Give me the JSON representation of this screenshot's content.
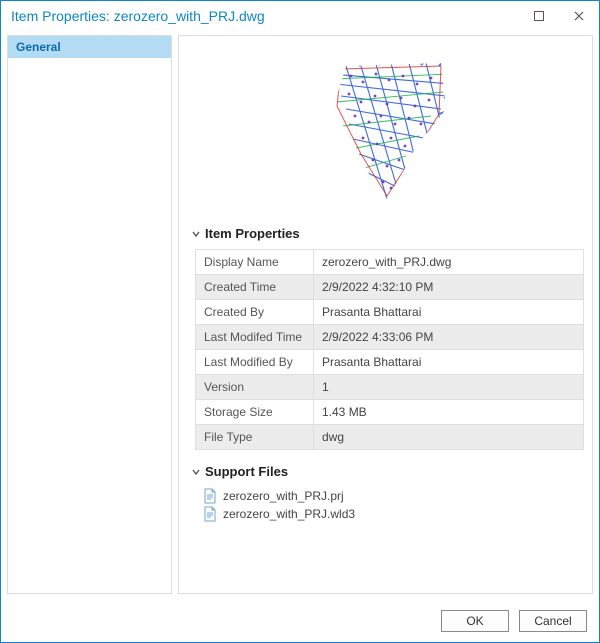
{
  "window": {
    "title": "Item Properties: zerozero_with_PRJ.dwg"
  },
  "sidebar": {
    "items": [
      {
        "label": "General",
        "selected": true
      }
    ]
  },
  "sections": {
    "item_properties": {
      "header": "Item Properties",
      "rows": [
        {
          "key": "Display Name",
          "value": "zerozero_with_PRJ.dwg"
        },
        {
          "key": "Created Time",
          "value": "2/9/2022 4:32:10 PM"
        },
        {
          "key": "Created By",
          "value": "Prasanta Bhattarai"
        },
        {
          "key": "Last Modifed Time",
          "value": "2/9/2022 4:33:06 PM"
        },
        {
          "key": "Last Modified By",
          "value": "Prasanta Bhattarai"
        },
        {
          "key": "Version",
          "value": "1"
        },
        {
          "key": "Storage Size",
          "value": "1.43 MB"
        },
        {
          "key": "File Type",
          "value": "dwg"
        }
      ]
    },
    "support_files": {
      "header": "Support Files",
      "files": [
        {
          "name": "zerozero_with_PRJ.prj"
        },
        {
          "name": "zerozero_with_PRJ.wld3"
        }
      ]
    }
  },
  "buttons": {
    "ok": "OK",
    "cancel": "Cancel"
  }
}
